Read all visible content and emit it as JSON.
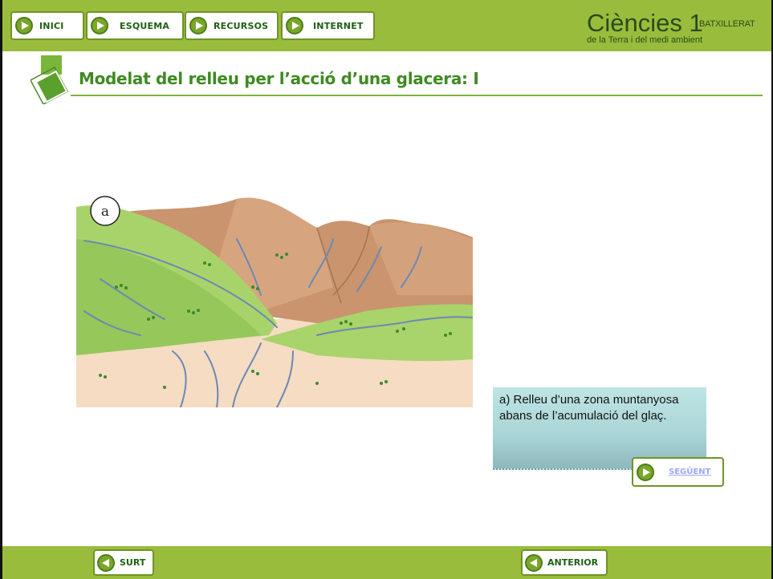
{
  "nav": {
    "items": [
      {
        "label": "INICI"
      },
      {
        "label": "ESQUEMA"
      },
      {
        "label": "RECURSOS"
      },
      {
        "label": "INTERNET"
      }
    ]
  },
  "brand": {
    "title": "Ciències 1",
    "badge": "BATXILLERAT",
    "subtitle": "de la Terra i del medi ambient"
  },
  "page": {
    "title": "Modelat del relleu per l’acció d’una glacera: I"
  },
  "figure": {
    "marker": "a"
  },
  "caption": {
    "text": "a) Relleu d’una zona muntanyosa abans de l’acumulació del glaç."
  },
  "buttons": {
    "next": "SEGÜENT",
    "exit": "SURT",
    "previous": "ANTERIOR"
  },
  "colors": {
    "bar_green": "#9abc3c",
    "title_green": "#3e8b22",
    "caption_bg": "#bfe5e4"
  },
  "icons": [
    "play-icon",
    "back-icon",
    "logo-squares-icon"
  ]
}
